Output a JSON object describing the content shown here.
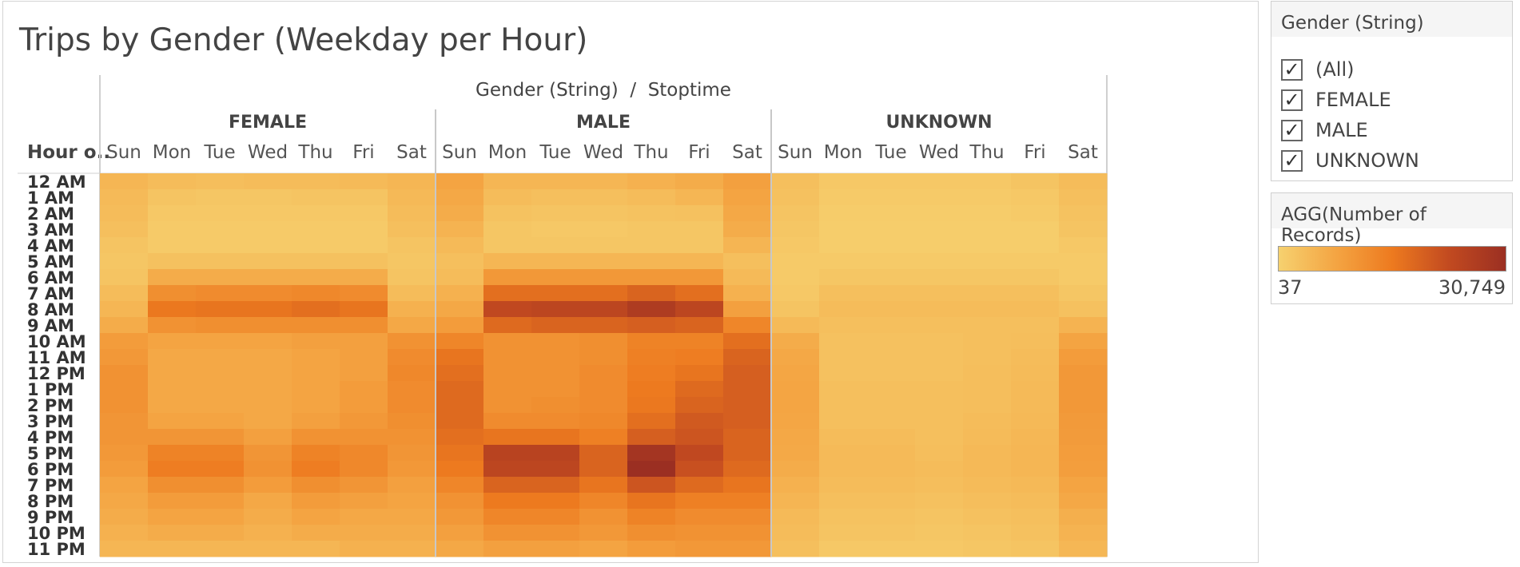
{
  "sheet_title": "Trips by Gender (Weekday per Hour)",
  "filter": {
    "title": "Gender (String)",
    "items": [
      {
        "label": "(All)",
        "checked": true
      },
      {
        "label": "FEMALE",
        "checked": true
      },
      {
        "label": "MALE",
        "checked": true
      },
      {
        "label": "UNKNOWN",
        "checked": true
      }
    ]
  },
  "color_legend": {
    "title": "AGG(Number of Records)",
    "min_label": "37",
    "max_label": "30,749",
    "colors": [
      "#f6d16f",
      "#f4a543",
      "#ed7a1f",
      "#c24a20",
      "#9b2f22"
    ]
  },
  "chart_data": {
    "type": "heatmap",
    "title": "Trips by Gender (Weekday per Hour)",
    "column_header": "Gender (String)  /  Stoptime",
    "row_header": "Hour o..",
    "groups": [
      "FEMALE",
      "MALE",
      "UNKNOWN"
    ],
    "days": [
      "Sun",
      "Mon",
      "Tue",
      "Wed",
      "Thu",
      "Fri",
      "Sat"
    ],
    "hours": [
      "12 AM",
      "1 AM",
      "2 AM",
      "3 AM",
      "4 AM",
      "5 AM",
      "6 AM",
      "7 AM",
      "8 AM",
      "9 AM",
      "10 AM",
      "11 AM",
      "12 PM",
      "1 PM",
      "2 PM",
      "3 PM",
      "4 PM",
      "5 PM",
      "6 PM",
      "7 PM",
      "8 PM",
      "9 PM",
      "10 PM",
      "11 PM"
    ],
    "value_range": [
      37,
      30749
    ],
    "values": {
      "FEMALE": [
        [
          1500,
          1000,
          900,
          1000,
          1000,
          1200,
          1500
        ],
        [
          1200,
          500,
          400,
          400,
          500,
          500,
          1300
        ],
        [
          1000,
          300,
          300,
          300,
          300,
          300,
          1000
        ],
        [
          800,
          200,
          200,
          200,
          200,
          200,
          800
        ],
        [
          500,
          200,
          200,
          200,
          200,
          200,
          500
        ],
        [
          400,
          700,
          700,
          700,
          700,
          700,
          400
        ],
        [
          500,
          2500,
          2500,
          2500,
          2500,
          2500,
          500
        ],
        [
          1000,
          6500,
          7000,
          7000,
          7500,
          7000,
          1000
        ],
        [
          1500,
          10500,
          11000,
          11000,
          12000,
          11000,
          2000
        ],
        [
          2500,
          6000,
          6500,
          6500,
          6500,
          6500,
          3000
        ],
        [
          4500,
          3500,
          3500,
          3500,
          4000,
          4000,
          6000
        ],
        [
          5000,
          3000,
          3000,
          3000,
          3500,
          4000,
          7000
        ],
        [
          6000,
          3000,
          3000,
          3000,
          3500,
          4000,
          7500
        ],
        [
          6000,
          3000,
          3000,
          3000,
          3500,
          4500,
          7000
        ],
        [
          6000,
          3000,
          3000,
          3000,
          3500,
          4500,
          7000
        ],
        [
          5500,
          3500,
          3500,
          3000,
          4000,
          5000,
          6500
        ],
        [
          5500,
          5500,
          5500,
          4000,
          6000,
          6000,
          6000
        ],
        [
          5000,
          8500,
          8500,
          5500,
          8500,
          7500,
          5500
        ],
        [
          4500,
          9500,
          9500,
          6000,
          9500,
          7500,
          5000
        ],
        [
          3500,
          6500,
          6500,
          4500,
          6500,
          5500,
          4000
        ],
        [
          3000,
          4500,
          4500,
          3000,
          4500,
          4000,
          3500
        ],
        [
          2500,
          3500,
          3500,
          2500,
          3500,
          3000,
          3000
        ],
        [
          2000,
          2500,
          2500,
          2000,
          2500,
          2500,
          2500
        ],
        [
          1500,
          1500,
          1500,
          1500,
          1500,
          2000,
          2000
        ]
      ],
      "MALE": [
        [
          3500,
          1500,
          1500,
          1500,
          2000,
          2500,
          4000
        ],
        [
          3000,
          1000,
          800,
          800,
          1000,
          1500,
          3500
        ],
        [
          2500,
          600,
          500,
          500,
          600,
          700,
          3000
        ],
        [
          1800,
          400,
          300,
          300,
          400,
          400,
          2500
        ],
        [
          1200,
          400,
          400,
          400,
          400,
          400,
          1600
        ],
        [
          800,
          1500,
          1500,
          1500,
          1500,
          1500,
          800
        ],
        [
          1000,
          5000,
          5000,
          5000,
          5000,
          5000,
          1200
        ],
        [
          2000,
          12000,
          12000,
          12000,
          14000,
          12000,
          2000
        ],
        [
          3000,
          20000,
          21000,
          21000,
          25000,
          21000,
          4000
        ],
        [
          4500,
          13000,
          14000,
          14000,
          15000,
          14000,
          8000
        ],
        [
          8000,
          6000,
          6000,
          6500,
          8500,
          8500,
          12000
        ],
        [
          11000,
          6000,
          6000,
          6500,
          9000,
          9500,
          14000
        ],
        [
          12000,
          6000,
          6000,
          7000,
          9500,
          11000,
          15000
        ],
        [
          13000,
          6000,
          6000,
          7000,
          10000,
          13000,
          15000
        ],
        [
          13000,
          6000,
          6500,
          7000,
          10500,
          14000,
          15000
        ],
        [
          13000,
          7000,
          7000,
          7500,
          12000,
          16000,
          15000
        ],
        [
          12000,
          11000,
          11000,
          9000,
          15000,
          17000,
          14000
        ],
        [
          11000,
          22000,
          22000,
          14000,
          28000,
          20000,
          14000
        ],
        [
          10000,
          21000,
          21000,
          14000,
          30749,
          18000,
          13000
        ],
        [
          8000,
          14000,
          14000,
          11000,
          17000,
          13000,
          11000
        ],
        [
          6000,
          10000,
          10000,
          8000,
          11000,
          9000,
          9000
        ],
        [
          5000,
          8000,
          8000,
          6000,
          8500,
          7000,
          7000
        ],
        [
          4000,
          6000,
          6000,
          5000,
          6500,
          6000,
          6000
        ],
        [
          3000,
          4000,
          4000,
          3500,
          4500,
          5000,
          5000
        ]
      ],
      "UNKNOWN": [
        [
          800,
          300,
          300,
          300,
          300,
          500,
          1000
        ],
        [
          700,
          200,
          200,
          200,
          200,
          300,
          800
        ],
        [
          500,
          150,
          150,
          150,
          150,
          200,
          600
        ],
        [
          400,
          100,
          100,
          100,
          100,
          100,
          500
        ],
        [
          300,
          100,
          100,
          100,
          100,
          100,
          300
        ],
        [
          200,
          200,
          200,
          200,
          200,
          200,
          200
        ],
        [
          200,
          400,
          400,
          400,
          400,
          400,
          200
        ],
        [
          300,
          800,
          800,
          800,
          800,
          800,
          400
        ],
        [
          500,
          1000,
          1000,
          1000,
          1000,
          1000,
          700
        ],
        [
          1200,
          800,
          800,
          800,
          800,
          800,
          1800
        ],
        [
          2500,
          700,
          700,
          700,
          800,
          900,
          3500
        ],
        [
          3000,
          700,
          700,
          700,
          800,
          1000,
          4500
        ],
        [
          3200,
          700,
          700,
          700,
          900,
          1100,
          5000
        ],
        [
          3300,
          800,
          800,
          800,
          900,
          1200,
          5000
        ],
        [
          3300,
          800,
          800,
          800,
          900,
          1200,
          5000
        ],
        [
          3200,
          800,
          800,
          800,
          1000,
          1300,
          4800
        ],
        [
          3000,
          1000,
          1000,
          800,
          1100,
          1400,
          4600
        ],
        [
          2800,
          1200,
          1200,
          900,
          1300,
          1500,
          4400
        ],
        [
          2500,
          1200,
          1200,
          1000,
          1300,
          1500,
          4200
        ],
        [
          2000,
          1000,
          1000,
          900,
          1100,
          1300,
          3500
        ],
        [
          1600,
          800,
          800,
          700,
          900,
          1000,
          3000
        ],
        [
          1200,
          600,
          600,
          500,
          700,
          800,
          2200
        ],
        [
          1000,
          500,
          500,
          400,
          500,
          700,
          1800
        ],
        [
          800,
          300,
          300,
          300,
          400,
          500,
          1400
        ]
      ]
    }
  }
}
